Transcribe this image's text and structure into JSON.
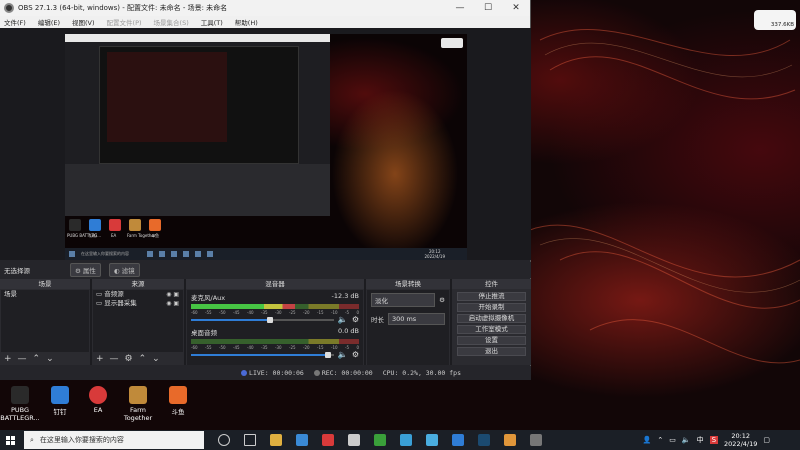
{
  "window": {
    "title": "OBS 27.1.3 (64-bit, windows) - 配置文件: 未命名 - 场景: 未命名",
    "controls": {
      "minimize": "—",
      "maximize": "☐",
      "close": "✕"
    }
  },
  "menu": [
    {
      "label": "文件(F)",
      "dim": false
    },
    {
      "label": "编辑(E)",
      "dim": false
    },
    {
      "label": "视图(V)",
      "dim": false
    },
    {
      "label": "配置文件(P)",
      "dim": true
    },
    {
      "label": "场景集合(S)",
      "dim": true
    },
    {
      "label": "工具(T)",
      "dim": false
    },
    {
      "label": "帮助(H)",
      "dim": false
    }
  ],
  "preview": {
    "inner_taskbar_search": "在这里输入你要搜索的内容",
    "inner_icons": [
      "PUBG BATTLEG...",
      "钉钉",
      "EA",
      "Farm Together",
      "斗鱼"
    ],
    "inner_clock_time": "20:12",
    "inner_clock_date": "2022/4/19"
  },
  "source_bar": {
    "label": "无选择源",
    "properties": "属性",
    "filters": "滤镜"
  },
  "docks": {
    "scenes": {
      "title": "场景",
      "items": [
        "场景"
      ]
    },
    "sources": {
      "title": "来源",
      "items": [
        "音频源",
        "显示器采集"
      ]
    },
    "mixer": {
      "title": "混音器",
      "channels": [
        {
          "name": "麦克风/Aux",
          "db": "-12.3 dB",
          "level": 0.62,
          "volume": 0.55
        },
        {
          "name": "桌面音频",
          "db": "0.0 dB",
          "level": 0.0,
          "volume": 0.96
        }
      ],
      "scale": [
        "-60",
        "-55",
        "-50",
        "-45",
        "-40",
        "-35",
        "-30",
        "-25",
        "-20",
        "-15",
        "-10",
        "-5",
        "0"
      ]
    },
    "transitions": {
      "title": "场景转换",
      "type": "淡化",
      "duration_label": "时长",
      "duration_value": "300 ms"
    },
    "controls": {
      "title": "控件",
      "buttons": [
        "停止推流",
        "开始录制",
        "启动虚拟摄像机",
        "工作室模式",
        "设置",
        "退出"
      ]
    }
  },
  "status": {
    "live": "LIVE: 00:00:06",
    "rec": "REC: 00:00:00",
    "cpu": "CPU: 0.2%, 30.00 fps"
  },
  "desktop_icons": [
    {
      "label": "PUBG BATTLEGR...",
      "color": "#2a2a2a"
    },
    {
      "label": "钉钉",
      "color": "#2f7dd6"
    },
    {
      "label": "EA",
      "color": "#d83a3a"
    },
    {
      "label": "Farm Together",
      "color": "#c08a3a"
    },
    {
      "label": "斗鱼",
      "color": "#e86a2a"
    }
  ],
  "widget": {
    "text": "337.6KB"
  },
  "taskbar": {
    "search_placeholder": "在这里输入你要搜索的内容",
    "tray_lang": "中",
    "tray_app": "S",
    "time": "20:12",
    "date": "2022/4/19",
    "icon_colors": [
      "#cccccc",
      "#cccccc",
      "#e0b040",
      "#3a8ad6",
      "#d83a3a",
      "#cccccc",
      "#3aa03a",
      "#3aa0d6",
      "#4aaee0",
      "#2f7dd6",
      "#1b4a70",
      "#e0963a",
      "#777777"
    ]
  }
}
